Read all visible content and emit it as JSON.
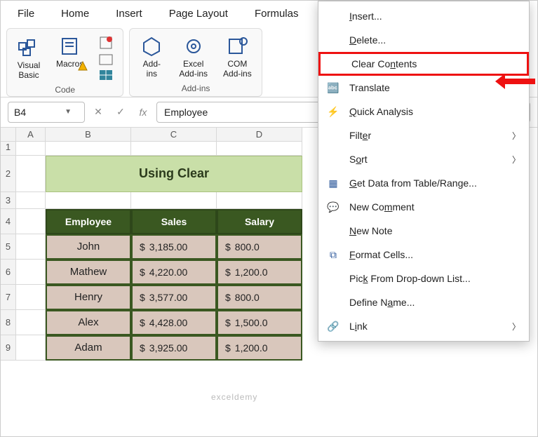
{
  "menubar": [
    "File",
    "Home",
    "Insert",
    "Page Layout",
    "Formulas"
  ],
  "ribbon": {
    "code": {
      "name": "Code",
      "visual": "Visual\nBasic",
      "macros": "Macros"
    },
    "addins": {
      "name": "Add-ins",
      "a1": "Add-\nins",
      "a2": "Excel\nAdd-ins",
      "a3": "COM\nAdd-ins"
    }
  },
  "fx": {
    "name": "B4",
    "value": "Employee"
  },
  "cols": [
    "A",
    "B",
    "C",
    "D"
  ],
  "rows": [
    "1",
    "2",
    "3",
    "4",
    "5",
    "6",
    "7",
    "8",
    "9"
  ],
  "banner": "Using Clear",
  "table": {
    "headers": [
      "Employee",
      "Sales",
      "Salary"
    ],
    "rows": [
      {
        "emp": "John",
        "sales": "3,185.00",
        "salary": "800.0"
      },
      {
        "emp": "Mathew",
        "sales": "4,220.00",
        "salary": "1,200.0"
      },
      {
        "emp": "Henry",
        "sales": "3,577.00",
        "salary": "800.0"
      },
      {
        "emp": "Alex",
        "sales": "4,428.00",
        "salary": "1,500.0"
      },
      {
        "emp": "Adam",
        "sales": "3,925.00",
        "salary": "1,200.0"
      }
    ]
  },
  "ctx": {
    "insert": "Insert...",
    "delete": "Delete...",
    "clear": "Clear Contents",
    "translate": "Translate",
    "quick": "Quick Analysis",
    "filter": "Filter",
    "sort": "Sort",
    "getdata": "Get Data from Table/Range...",
    "comment": "New Comment",
    "note": "New Note",
    "format": "Format Cells...",
    "pick": "Pick From Drop-down List...",
    "define": "Define Name...",
    "link": "Link"
  },
  "watermark": "exceldemy"
}
